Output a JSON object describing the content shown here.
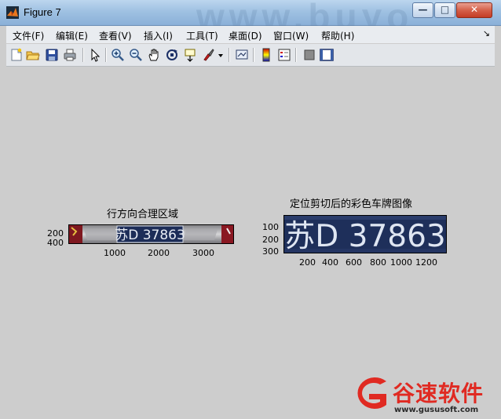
{
  "window": {
    "title": "Figure 7",
    "bg_watermark": "www.buyo",
    "controls": {
      "minimize": "—",
      "maximize": "□",
      "close": "✕"
    }
  },
  "menu": {
    "items": [
      "文件(F)",
      "编辑(E)",
      "查看(V)",
      "插入(I)",
      "工具(T)",
      "桌面(D)",
      "窗口(W)",
      "帮助(H)"
    ],
    "dock_arrow": "↘"
  },
  "toolbar": {
    "icons": [
      "new-figure-icon",
      "open-file-icon",
      "save-icon",
      "print-icon",
      "edit-plot-arrow-icon",
      "zoom-in-icon",
      "zoom-out-icon",
      "pan-hand-icon",
      "rotate-3d-icon",
      "data-cursor-icon",
      "brush-icon",
      "brush-dropdown-icon",
      "link-plot-icon",
      "colorbar-icon",
      "legend-icon",
      "hide-plot-tools-icon",
      "show-plot-tools-icon"
    ]
  },
  "axes_left": {
    "title": "行方向合理区域",
    "y_ticks": [
      "200",
      "400"
    ],
    "x_ticks": [
      "1000",
      "2000",
      "3000"
    ],
    "plate_text": "苏D 37863"
  },
  "axes_right": {
    "title": "定位剪切后的彩色车牌图像",
    "y_ticks": [
      "100",
      "200",
      "300"
    ],
    "x_ticks": [
      "200",
      "400",
      "600",
      "800",
      "1000",
      "1200"
    ],
    "plate_text": "苏D 37863"
  },
  "watermark": {
    "brand": "谷速软件",
    "url": "www.gususoft.com",
    "color": "#e02a22"
  }
}
